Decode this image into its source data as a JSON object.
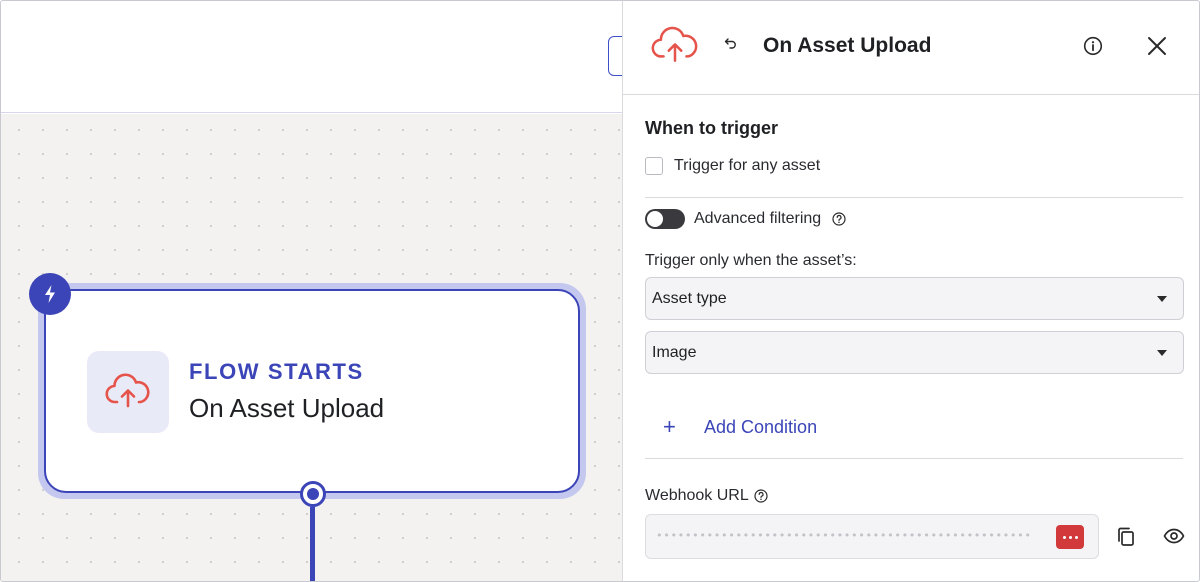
{
  "canvas": {
    "node": {
      "kicker": "FLOW STARTS",
      "title": "On Asset Upload",
      "icon": "cloud-upload-icon",
      "trigger_badge_icon": "lightning-bolt-icon"
    }
  },
  "panel": {
    "title": "On Asset Upload",
    "icons": {
      "header": "cloud-upload-icon",
      "back": "undo-icon",
      "info": "info-icon",
      "close": "close-icon"
    },
    "when_to_trigger": {
      "heading": "When to trigger",
      "any_asset_label": "Trigger for any asset",
      "any_asset_checked": false
    },
    "advanced_filtering": {
      "label": "Advanced filtering",
      "enabled": true
    },
    "filter": {
      "caption": "Trigger only when the asset’s:",
      "field_select": "Asset type",
      "value_select": "Image",
      "add_condition_label": "Add Condition"
    },
    "webhook": {
      "label": "Webhook URL",
      "masked_value": "••••••••••••••••••••••••••••••••••••••••••••••••••••"
    }
  },
  "colors": {
    "accent": "#3b45b8",
    "icon_red": "#e5534b",
    "badge_red": "#d2393a",
    "canvas_bg": "#f3f2f1"
  }
}
